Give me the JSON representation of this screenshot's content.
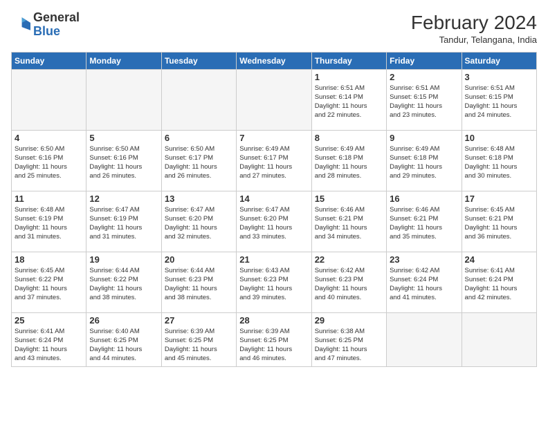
{
  "header": {
    "logo_general": "General",
    "logo_blue": "Blue",
    "main_title": "February 2024",
    "subtitle": "Tandur, Telangana, India"
  },
  "weekdays": [
    "Sunday",
    "Monday",
    "Tuesday",
    "Wednesday",
    "Thursday",
    "Friday",
    "Saturday"
  ],
  "weeks": [
    [
      {
        "day": "",
        "info": "",
        "empty": true
      },
      {
        "day": "",
        "info": "",
        "empty": true
      },
      {
        "day": "",
        "info": "",
        "empty": true
      },
      {
        "day": "",
        "info": "",
        "empty": true
      },
      {
        "day": "1",
        "info": "Sunrise: 6:51 AM\nSunset: 6:14 PM\nDaylight: 11 hours\nand 22 minutes."
      },
      {
        "day": "2",
        "info": "Sunrise: 6:51 AM\nSunset: 6:15 PM\nDaylight: 11 hours\nand 23 minutes."
      },
      {
        "day": "3",
        "info": "Sunrise: 6:51 AM\nSunset: 6:15 PM\nDaylight: 11 hours\nand 24 minutes."
      }
    ],
    [
      {
        "day": "4",
        "info": "Sunrise: 6:50 AM\nSunset: 6:16 PM\nDaylight: 11 hours\nand 25 minutes."
      },
      {
        "day": "5",
        "info": "Sunrise: 6:50 AM\nSunset: 6:16 PM\nDaylight: 11 hours\nand 26 minutes."
      },
      {
        "day": "6",
        "info": "Sunrise: 6:50 AM\nSunset: 6:17 PM\nDaylight: 11 hours\nand 26 minutes."
      },
      {
        "day": "7",
        "info": "Sunrise: 6:49 AM\nSunset: 6:17 PM\nDaylight: 11 hours\nand 27 minutes."
      },
      {
        "day": "8",
        "info": "Sunrise: 6:49 AM\nSunset: 6:18 PM\nDaylight: 11 hours\nand 28 minutes."
      },
      {
        "day": "9",
        "info": "Sunrise: 6:49 AM\nSunset: 6:18 PM\nDaylight: 11 hours\nand 29 minutes."
      },
      {
        "day": "10",
        "info": "Sunrise: 6:48 AM\nSunset: 6:18 PM\nDaylight: 11 hours\nand 30 minutes."
      }
    ],
    [
      {
        "day": "11",
        "info": "Sunrise: 6:48 AM\nSunset: 6:19 PM\nDaylight: 11 hours\nand 31 minutes."
      },
      {
        "day": "12",
        "info": "Sunrise: 6:47 AM\nSunset: 6:19 PM\nDaylight: 11 hours\nand 31 minutes."
      },
      {
        "day": "13",
        "info": "Sunrise: 6:47 AM\nSunset: 6:20 PM\nDaylight: 11 hours\nand 32 minutes."
      },
      {
        "day": "14",
        "info": "Sunrise: 6:47 AM\nSunset: 6:20 PM\nDaylight: 11 hours\nand 33 minutes."
      },
      {
        "day": "15",
        "info": "Sunrise: 6:46 AM\nSunset: 6:21 PM\nDaylight: 11 hours\nand 34 minutes."
      },
      {
        "day": "16",
        "info": "Sunrise: 6:46 AM\nSunset: 6:21 PM\nDaylight: 11 hours\nand 35 minutes."
      },
      {
        "day": "17",
        "info": "Sunrise: 6:45 AM\nSunset: 6:21 PM\nDaylight: 11 hours\nand 36 minutes."
      }
    ],
    [
      {
        "day": "18",
        "info": "Sunrise: 6:45 AM\nSunset: 6:22 PM\nDaylight: 11 hours\nand 37 minutes."
      },
      {
        "day": "19",
        "info": "Sunrise: 6:44 AM\nSunset: 6:22 PM\nDaylight: 11 hours\nand 38 minutes."
      },
      {
        "day": "20",
        "info": "Sunrise: 6:44 AM\nSunset: 6:23 PM\nDaylight: 11 hours\nand 38 minutes."
      },
      {
        "day": "21",
        "info": "Sunrise: 6:43 AM\nSunset: 6:23 PM\nDaylight: 11 hours\nand 39 minutes."
      },
      {
        "day": "22",
        "info": "Sunrise: 6:42 AM\nSunset: 6:23 PM\nDaylight: 11 hours\nand 40 minutes."
      },
      {
        "day": "23",
        "info": "Sunrise: 6:42 AM\nSunset: 6:24 PM\nDaylight: 11 hours\nand 41 minutes."
      },
      {
        "day": "24",
        "info": "Sunrise: 6:41 AM\nSunset: 6:24 PM\nDaylight: 11 hours\nand 42 minutes."
      }
    ],
    [
      {
        "day": "25",
        "info": "Sunrise: 6:41 AM\nSunset: 6:24 PM\nDaylight: 11 hours\nand 43 minutes."
      },
      {
        "day": "26",
        "info": "Sunrise: 6:40 AM\nSunset: 6:25 PM\nDaylight: 11 hours\nand 44 minutes."
      },
      {
        "day": "27",
        "info": "Sunrise: 6:39 AM\nSunset: 6:25 PM\nDaylight: 11 hours\nand 45 minutes."
      },
      {
        "day": "28",
        "info": "Sunrise: 6:39 AM\nSunset: 6:25 PM\nDaylight: 11 hours\nand 46 minutes."
      },
      {
        "day": "29",
        "info": "Sunrise: 6:38 AM\nSunset: 6:25 PM\nDaylight: 11 hours\nand 47 minutes."
      },
      {
        "day": "",
        "info": "",
        "empty": true
      },
      {
        "day": "",
        "info": "",
        "empty": true
      }
    ]
  ]
}
